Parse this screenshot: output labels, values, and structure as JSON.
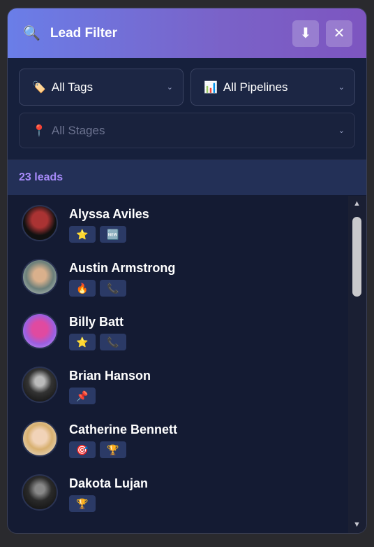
{
  "header": {
    "title": "Lead Filter",
    "download_icon": "download-icon",
    "close_icon": "close-icon"
  },
  "filters": {
    "tags": {
      "icon": "🏷️",
      "label": "All Tags"
    },
    "pipelines": {
      "icon": "📊",
      "label": "All Pipelines"
    },
    "stages": {
      "icon": "📍",
      "label": "All Stages"
    }
  },
  "count_label": "23 leads",
  "leads": [
    {
      "name": "Alyssa Aviles",
      "tags": [
        "⭐",
        "🆕"
      ]
    },
    {
      "name": "Austin Armstrong",
      "tags": [
        "🔥",
        "📞"
      ]
    },
    {
      "name": "Billy Batt",
      "tags": [
        "⭐",
        "📞"
      ]
    },
    {
      "name": "Brian Hanson",
      "tags": [
        "📌"
      ]
    },
    {
      "name": "Catherine Bennett",
      "tags": [
        "🎯",
        "🏆"
      ]
    },
    {
      "name": "Dakota Lujan",
      "tags": [
        "🏆"
      ]
    }
  ],
  "colors": {
    "header_start": "#6a7ee8",
    "header_end": "#7d55c0",
    "accent": "#a78bfa",
    "background": "#141b33"
  }
}
